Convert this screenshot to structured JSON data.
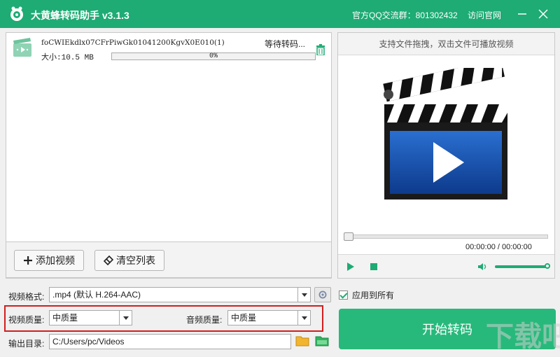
{
  "titlebar": {
    "title": "大黄蜂转码助手 v3.1.3",
    "qq_group": "官方QQ交流群：801302432",
    "visit_site": "访问官网"
  },
  "file_list": {
    "items": [
      {
        "name": "foCWIEkdlx07CFrPiwGk01041200KgvX0E010(1)",
        "status": "等待转码...",
        "size": "大小:10.5 MB",
        "progress_text": "0%",
        "progress": 0
      }
    ],
    "add_video_label": "添加视频",
    "clear_list_label": "清空列表"
  },
  "preview": {
    "hint": "支持文件拖拽，双击文件可播放视频",
    "time": "00:00:00 / 00:00:00",
    "volume_level": 1.0,
    "seek_position": 0
  },
  "settings": {
    "format_label": "视频格式:",
    "format_value": ".mp4 (默认 H.264-AAC)",
    "apply_all_label": "应用到所有",
    "apply_all_checked": true,
    "video_quality_label": "视频质量:",
    "video_quality_value": "中质量",
    "audio_quality_label": "音频质量:",
    "audio_quality_value": "中质量",
    "output_label": "输出目录:",
    "output_value": "C:/Users/pc/Videos"
  },
  "start_button": {
    "label": "开始转码"
  },
  "colors": {
    "accent": "#1eab74",
    "start": "#27b97b",
    "highlight": "#d11f1f"
  }
}
